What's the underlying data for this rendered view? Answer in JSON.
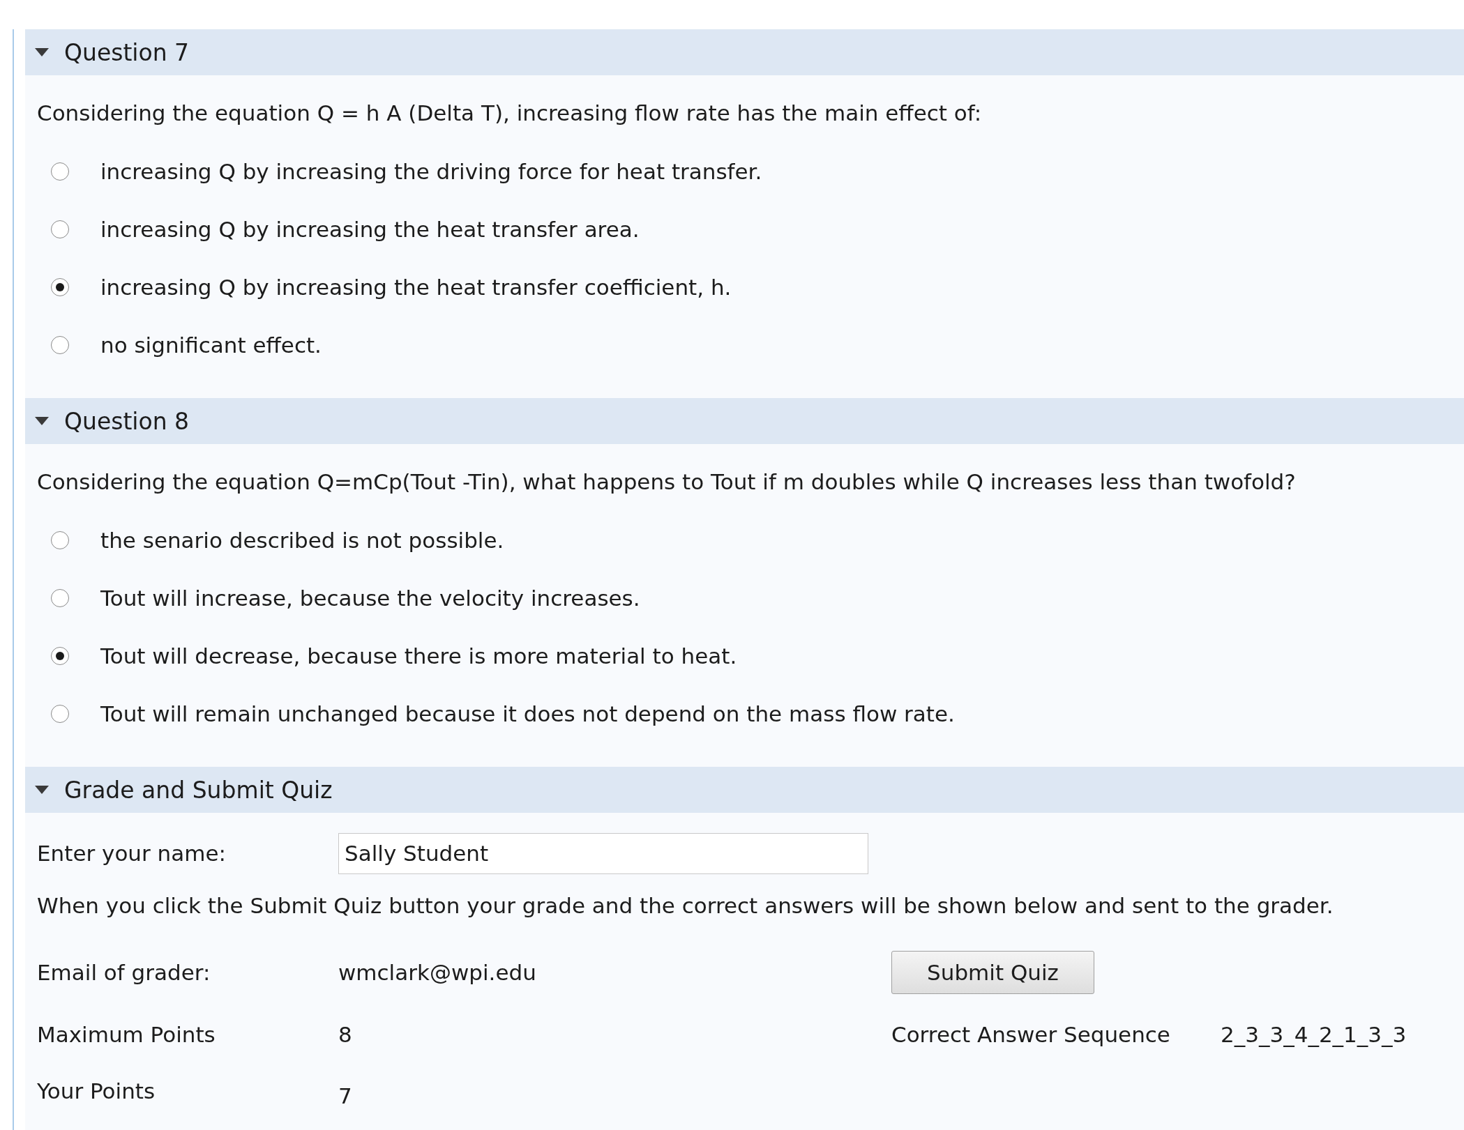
{
  "questions": [
    {
      "title": "Question 7",
      "expanded": true,
      "prompt": "Considering the equation Q = h A (Delta T), increasing flow rate has the main effect of:",
      "options": [
        {
          "label": "increasing Q by increasing the driving force for heat transfer.",
          "selected": false
        },
        {
          "label": "increasing Q by increasing the heat transfer area.",
          "selected": false
        },
        {
          "label": "increasing Q by increasing the heat transfer coefficient, h.",
          "selected": true
        },
        {
          "label": "no significant effect.",
          "selected": false
        }
      ]
    },
    {
      "title": "Question 8",
      "expanded": true,
      "prompt": "Considering the equation Q=mCp(Tout -Tin), what happens to Tout if m doubles while Q increases less than twofold?",
      "options": [
        {
          "label": "the senario described is not possible.",
          "selected": false
        },
        {
          "label": "Tout will increase, because the velocity increases.",
          "selected": false
        },
        {
          "label": "Tout will decrease, because there is more material to heat.",
          "selected": true
        },
        {
          "label": "Tout will remain unchanged because it does not depend on the mass flow rate.",
          "selected": false
        }
      ]
    }
  ],
  "grade": {
    "title": "Grade and Submit Quiz",
    "expanded": true,
    "name_label": "Enter your name:",
    "name_value": "Sally Student",
    "instruction": "When you click the Submit Quiz button your grade and the correct answers will be shown below and sent to the grader.",
    "email_label": "Email of grader:",
    "email": "wmclark@wpi.edu",
    "submit": "Submit Quiz",
    "max_label": "Maximum Points",
    "max_value": "8",
    "answer_label": "Correct Answer Sequence",
    "answer_value": "2_3_3_4_2_1_3_3",
    "points_label": "Your Points",
    "points_value": "7"
  }
}
